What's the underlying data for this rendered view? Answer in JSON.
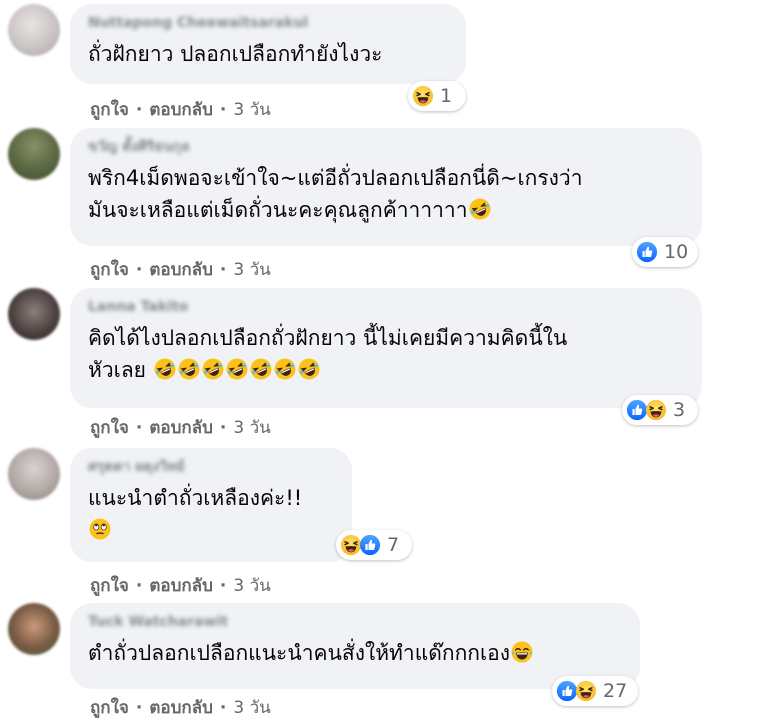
{
  "actions": {
    "like_label": "ถูกใจ",
    "reply_label": "ตอบกลับ",
    "separator": "·"
  },
  "comments": [
    {
      "author": "Nuttapong Cheewaitsarakul",
      "text": "ถั่วฝักยาว ปลอกเปลือกทำยังไงวะ",
      "time": "3 วัน",
      "reaction_count": "1",
      "reaction_icons": [
        "haha-icon"
      ]
    },
    {
      "author": "ขวัญ ตั้งศิริธนกุล",
      "text_line1": "พริก4เม็ดพอจะเข้าใจ~แต่อีถั่วปลอกเปลือกนี่ดิ~เกรงว่า",
      "text_line2": "มันจะเหลือแต่เม็ดถั่วนะคะคุณลูกค้าาาาาา",
      "trailing_emoji": "rofl-icon",
      "time": "3 วัน",
      "reaction_count": "10",
      "reaction_icons": [
        "like-icon"
      ]
    },
    {
      "author": "Lanna Takito",
      "text_line1": "คิดได้ไงปลอกเปลือกถั่วฝักยาว นี้ไม่เคยมีความคิดนี้ใน",
      "text_line2": "หัวเลย",
      "trailing_emoji": "rofl-icon",
      "trailing_emoji_count": 7,
      "time": "3 วัน",
      "reaction_count": "3",
      "reaction_icons": [
        "like-icon",
        "haha-icon"
      ]
    },
    {
      "author": "ศรุตตา ผดุงวิทย์",
      "text_line1": "แนะนำตำถั่วเหลืองค่ะ!!",
      "trailing_emoji": "rolling-eyes-icon",
      "time": "3 วัน",
      "reaction_count": "7",
      "reaction_icons": [
        "haha-icon",
        "like-icon"
      ]
    },
    {
      "author": "Tuck Watcharawit",
      "text": "ตำถั่วปลอกเปลือกแนะนำคนสั่งให้ทำแด๊กกกเอง",
      "trailing_emoji": "laughing-tears-icon",
      "time": "3 วัน",
      "reaction_count": "27",
      "reaction_icons": [
        "like-icon",
        "haha-icon"
      ]
    }
  ],
  "colors": {
    "bubble": "#f0f2f5",
    "text": "#050505",
    "meta": "#65676b",
    "like_blue": "#1877f2",
    "haha_yellow": "#f7b928"
  }
}
